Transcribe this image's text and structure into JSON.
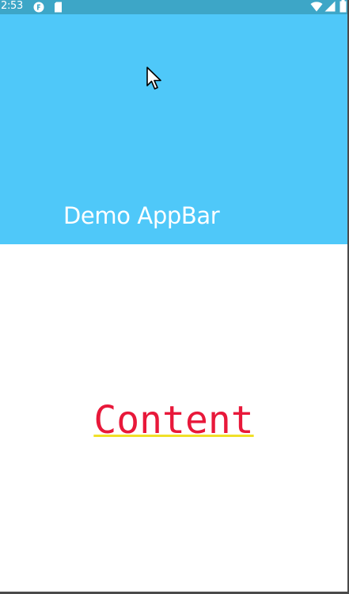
{
  "status_bar": {
    "time": "2:53",
    "icons": [
      "notification-f-icon",
      "sd-card-icon",
      "wifi-icon",
      "signal-icon",
      "battery-icon"
    ],
    "background": "#3da6c7"
  },
  "app_bar": {
    "title": "Demo AppBar",
    "background": "#4fc8f9"
  },
  "body": {
    "content_text": "Content",
    "content_color": "#e8183a",
    "underline_color": "#f0e028"
  }
}
